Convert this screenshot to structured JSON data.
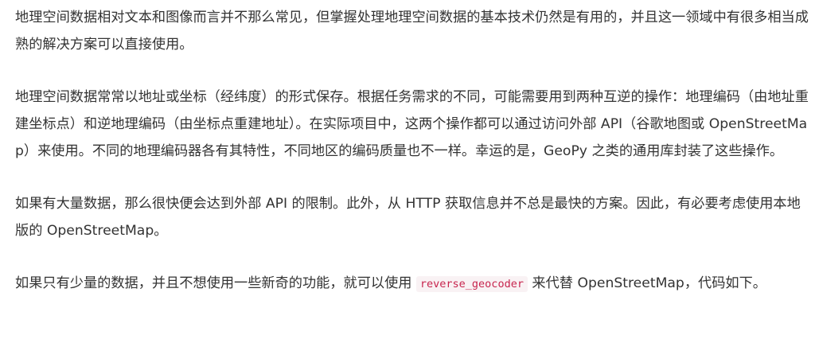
{
  "article": {
    "paragraphs": [
      {
        "text": "地理空间数据相对文本和图像而言并不那么常见，但掌握处理地理空间数据的基本技术仍然是有用的，并且这一领域中有很多相当成熟的解决方案可以直接使用。"
      },
      {
        "text": "地理空间数据常常以地址或坐标（经纬度）的形式保存。根据任务需求的不同，可能需要用到两种互逆的操作：地理编码（由地址重建坐标点）和逆地理编码（由坐标点重建地址）。在实际项目中，这两个操作都可以通过访问外部 API（谷歌地图或 OpenStreetMap）来使用。不同的地理编码器各有其特性，不同地区的编码质量也不一样。幸运的是，GeoPy 之类的通用库封装了这些操作。"
      },
      {
        "text": "如果有大量数据，那么很快便会达到外部 API 的限制。此外，从 HTTP 获取信息并不总是最快的方案。因此，有必要考虑使用本地版的 OpenStreetMap。"
      },
      {
        "before_code": "如果只有少量的数据，并且不想使用一些新奇的功能，就可以使用 ",
        "code": "reverse_geocoder",
        "after_code": " 来代替 OpenStreetMap，代码如下。"
      }
    ]
  }
}
